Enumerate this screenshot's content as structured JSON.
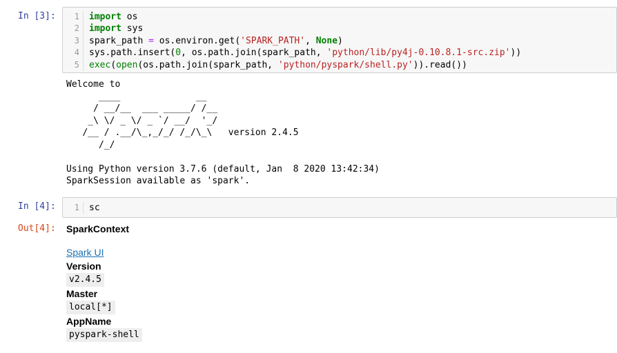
{
  "cells": [
    {
      "prompt": "In [3]:",
      "lines": [
        {
          "no": "1"
        },
        {
          "no": "2"
        },
        {
          "no": "3"
        },
        {
          "no": "4"
        },
        {
          "no": "5"
        }
      ]
    },
    {
      "prompt": "In [4]:",
      "lines": [
        {
          "no": "1",
          "text": "sc"
        }
      ]
    }
  ],
  "code": {
    "l1_kw": "import",
    "l1_rest": " os",
    "l2_kw": "import",
    "l2_rest": " sys",
    "l3_a": "spark_path ",
    "l3_op": "=",
    "l3_b": " os.environ.get(",
    "l3_str": "'SPARK_PATH'",
    "l3_c": ", ",
    "l3_kw": "None",
    "l3_d": ")",
    "l4_a": "sys.path.insert(",
    "l4_num": "0",
    "l4_b": ", os.path.join(spark_path, ",
    "l4_str": "'python/lib/py4j-0.10.8.1-src.zip'",
    "l4_c": "))",
    "l5_bi1": "exec",
    "l5_a": "(",
    "l5_bi2": "open",
    "l5_b": "(os.path.join(spark_path, ",
    "l5_str": "'python/pyspark/shell.py'",
    "l5_c": ")).read())"
  },
  "stream_output": "Welcome to\n      ____              __\n     / __/__  ___ _____/ /__\n    _\\ \\/ _ \\/ _ `/ __/  '_/\n   /__ / .__/\\_,_/_/ /_/\\_\\   version 2.4.5\n      /_/\n\nUsing Python version 3.7.6 (default, Jan  8 2020 13:42:34)\nSparkSession available as 'spark'.",
  "out_prompt": "Out[4]:",
  "spark_context": {
    "title": "SparkContext",
    "link": "Spark UI",
    "version_label": "Version",
    "version_value": "v2.4.5",
    "master_label": "Master",
    "master_value": "local[*]",
    "appname_label": "AppName",
    "appname_value": "pyspark-shell"
  },
  "colors": {
    "in_prompt": "#303f9f",
    "out_prompt": "#d84315",
    "keyword": "#008000",
    "string": "#ba2121",
    "link": "#1a6fb0"
  }
}
